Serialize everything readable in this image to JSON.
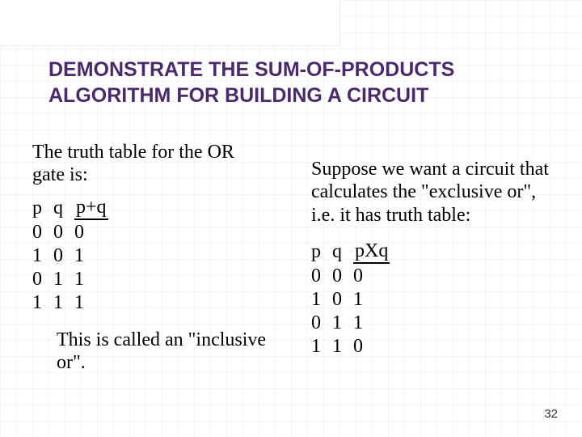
{
  "title": "DEMONSTRATE THE SUM-OF-PRODUCTS ALGORITHM FOR BUILDING A CIRCUIT",
  "left": {
    "intro": "The truth table for the OR gate is:",
    "headers": {
      "p": "p",
      "q": "q",
      "out": "p+q"
    },
    "rows": [
      {
        "p": "0",
        "q": "0",
        "out": "0"
      },
      {
        "p": "1",
        "q": "0",
        "out": "1"
      },
      {
        "p": "0",
        "q": "1",
        "out": "1"
      },
      {
        "p": "1",
        "q": "1",
        "out": "1"
      }
    ],
    "note": "This is called an \"inclusive or\"."
  },
  "right": {
    "intro": "Suppose we want a circuit that calculates the \"exclusive or\", i.e. it has truth table:",
    "headers": {
      "p": "p",
      "q": "q",
      "out_pre": "p",
      "out_mid": "X",
      "out_post": "q"
    },
    "rows": [
      {
        "p": "0",
        "q": "0",
        "out": "0"
      },
      {
        "p": "1",
        "q": "0",
        "out": "1"
      },
      {
        "p": "0",
        "q": "1",
        "out": "1"
      },
      {
        "p": "1",
        "q": "1",
        "out": "0"
      }
    ]
  },
  "page_number": "32"
}
